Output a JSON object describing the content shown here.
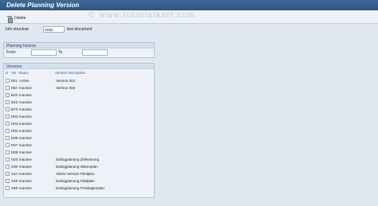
{
  "title": "Delete Planning Version",
  "watermark": "© www.tutorialkart.com",
  "toolbar": {
    "delete_label": "Delete"
  },
  "info": {
    "label": "Info structure",
    "value": "S082",
    "description": "test document"
  },
  "horizon": {
    "title": "Planning horizon",
    "from_label": "From",
    "to_label": "To",
    "from_value": "",
    "to_value": ""
  },
  "versions": {
    "title": "Versions",
    "columns": {
      "d": "D",
      "ver": "Ver",
      "status": "Status",
      "desc": "Version description"
    },
    "rows": [
      {
        "ver": "001",
        "status": "Active",
        "desc": "Version 001"
      },
      {
        "ver": "002",
        "status": "Inactive",
        "desc": "Version 002"
      },
      {
        "ver": "B32",
        "status": "Inactive",
        "desc": ""
      },
      {
        "ver": "B42",
        "status": "Inactive",
        "desc": ""
      },
      {
        "ver": "B73",
        "status": "Inactive",
        "desc": ""
      },
      {
        "ver": "D02",
        "status": "Inactive",
        "desc": ""
      },
      {
        "ver": "D03",
        "status": "Inactive",
        "desc": ""
      },
      {
        "ver": "D04",
        "status": "Inactive",
        "desc": ""
      },
      {
        "ver": "D05",
        "status": "Inactive",
        "desc": ""
      },
      {
        "ver": "D07",
        "status": "Inactive",
        "desc": ""
      },
      {
        "ver": "D09",
        "status": "Inactive",
        "desc": ""
      },
      {
        "ver": "S20",
        "status": "Inactive",
        "desc": "Dialogplanung Zielsetzung"
      },
      {
        "ver": "S30",
        "status": "Inactive",
        "desc": "Dialogplanung Warenplan"
      },
      {
        "ver": "S4A",
        "status": "Inactive",
        "desc": "Aktive Version Filialplan"
      },
      {
        "ver": "S40",
        "status": "Inactive",
        "desc": "Dialogplanung Filialplan"
      },
      {
        "ver": "S50",
        "status": "Inactive",
        "desc": "Dialogplanung Preislagenplan"
      }
    ]
  }
}
